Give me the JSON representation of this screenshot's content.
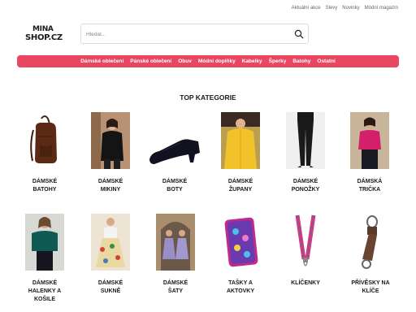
{
  "header": {
    "links": [
      "Aktuální akce",
      "Slevy",
      "Novinky",
      "Módní magazín"
    ],
    "logo": {
      "line1": "MINA",
      "line2": "SHOP.CZ"
    },
    "search": {
      "placeholder": "Hledat..."
    }
  },
  "nav": {
    "items": [
      "Dámské oblečení",
      "Pánské oblečení",
      "Obuv",
      "Módní doplňky",
      "Kabelky",
      "Šperky",
      "Batohy",
      "Ostatní"
    ]
  },
  "main": {
    "title": "TOP KATEGORIE",
    "categories": [
      {
        "line1": "DÁMSKÉ",
        "line2": "BATOHY",
        "line3": "",
        "image": "brown-backpack"
      },
      {
        "line1": "DÁMSKÉ",
        "line2": "MIKINY",
        "line3": "",
        "image": "black-hoodie-model"
      },
      {
        "line1": "DÁMSKÉ",
        "line2": "BOTY",
        "line3": "",
        "image": "black-heel-shoe"
      },
      {
        "line1": "DÁMSKÉ",
        "line2": "ŽUPANY",
        "line3": "",
        "image": "yellow-robe"
      },
      {
        "line1": "DÁMSKÉ",
        "line2": "PONOŽKY",
        "line3": "",
        "image": "black-tights-legs"
      },
      {
        "line1": "DÁMSKÁ",
        "line2": "TRIČKA",
        "line3": "",
        "image": "pink-shirt-model"
      },
      {
        "line1": "DÁMSKÉ",
        "line2": "HALENKY A",
        "line3": "KOŠILE",
        "image": "green-blouse-model"
      },
      {
        "line1": "DÁMSKÉ",
        "line2": "SUKNĚ",
        "line3": "",
        "image": "floral-skirt-model"
      },
      {
        "line1": "DÁMSKÉ",
        "line2": "ŠATY",
        "line3": "",
        "image": "dresses-two-models"
      },
      {
        "line1": "TAŠKY A",
        "line2": "AKTOVKY",
        "line3": "",
        "image": "butterfly-pencil-case"
      },
      {
        "line1": "KLÍČENKY",
        "line2": "",
        "line3": "",
        "image": "lanyard"
      },
      {
        "line1": "PŘÍVĚSKY NA",
        "line2": "KLÍČE",
        "line3": "",
        "image": "leather-keychain"
      }
    ]
  },
  "colors": {
    "accent": "#e8475f",
    "text": "#1a1a1a"
  }
}
